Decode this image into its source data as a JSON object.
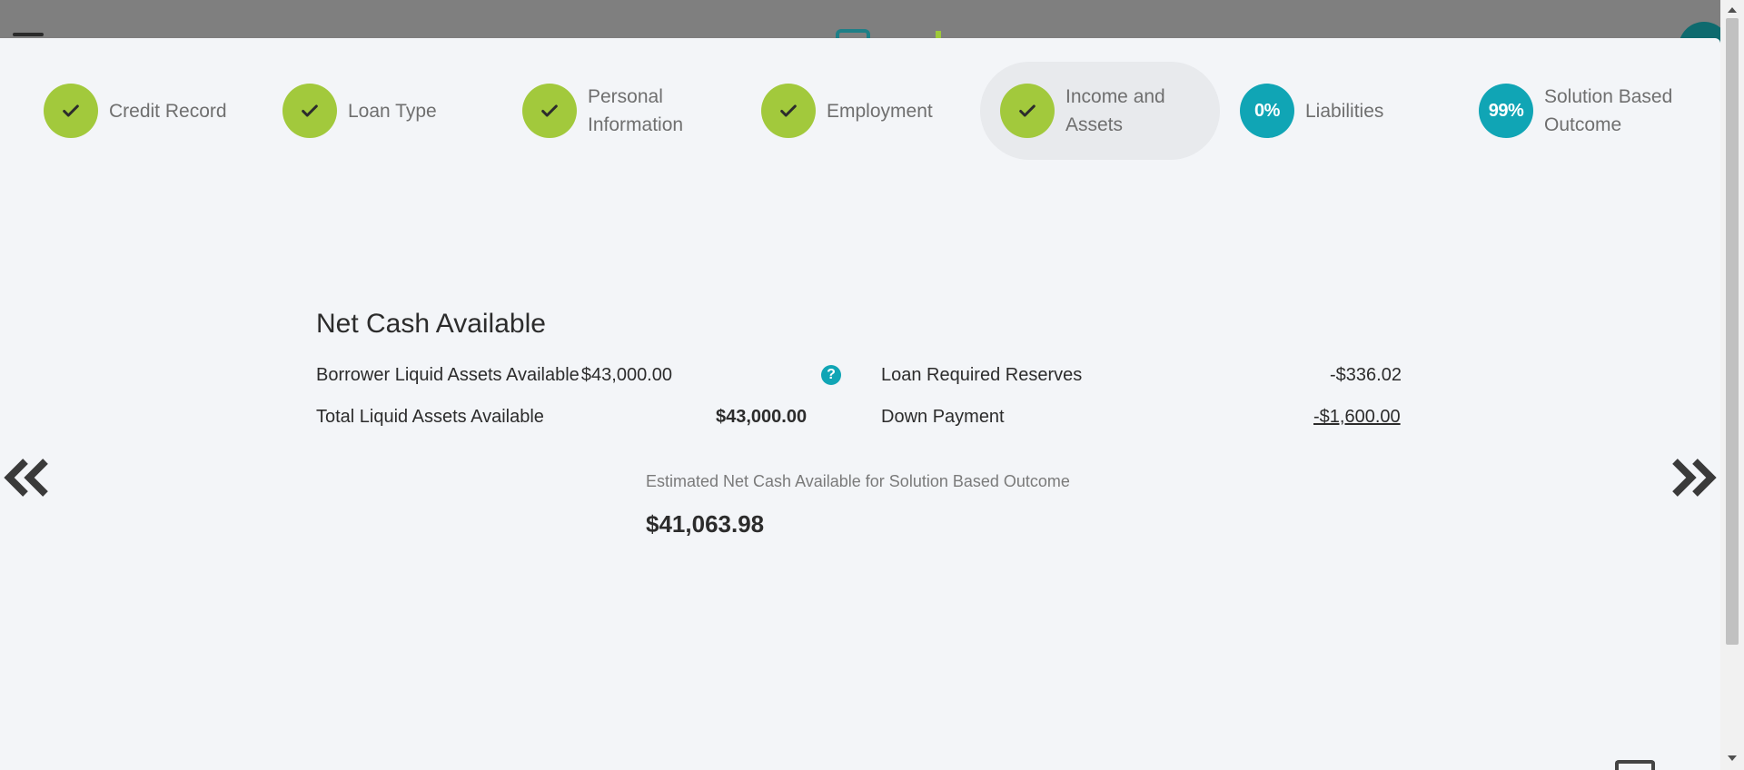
{
  "steps": [
    {
      "label": "Credit Record",
      "status": "done"
    },
    {
      "label": "Loan Type",
      "status": "done"
    },
    {
      "label": "Personal Information",
      "status": "done"
    },
    {
      "label": "Employment",
      "status": "done"
    },
    {
      "label": "Income and Assets",
      "status": "done",
      "active": true
    },
    {
      "label": "Liabilities",
      "status": "percent",
      "badge": "0%"
    },
    {
      "label": "Solution Based Outcome",
      "status": "percent",
      "badge": "99%"
    }
  ],
  "section": {
    "title": "Net Cash Available",
    "rows_left": [
      {
        "label": "Borrower Liquid Assets Available",
        "value": "$43,000.00"
      },
      {
        "label": "Total Liquid Assets Available",
        "value": "$43,000.00"
      }
    ],
    "rows_right": [
      {
        "label": "Loan Required Reserves",
        "value": "-$336.02"
      },
      {
        "label": "Down Payment",
        "value": "-$1,600.00"
      }
    ],
    "help_icon": "?",
    "estimate_label": "Estimated Net Cash Available for Solution Based Outcome",
    "estimate_value": "$41,063.98"
  },
  "icons": {
    "check": "check-icon",
    "prev": "double-chevron-left-icon",
    "next": "double-chevron-right-icon",
    "help": "question-icon"
  },
  "colors": {
    "complete": "#a2c93c",
    "percent": "#10a5b5",
    "modal_bg": "#f3f5f8",
    "overlay": "#808080"
  }
}
